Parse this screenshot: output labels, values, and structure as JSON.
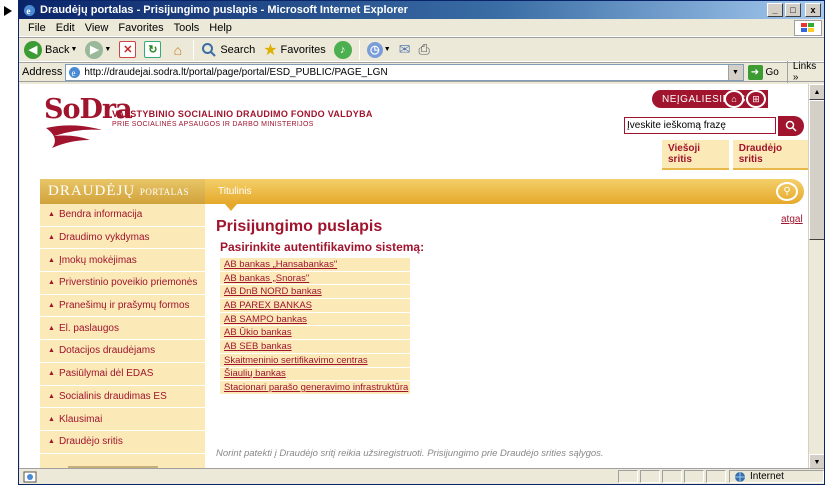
{
  "window": {
    "title": "Draudėjų portalas - Prisijungimo puslapis - Microsoft Internet Explorer",
    "minimize": "_",
    "maximize": "□",
    "close": "x"
  },
  "menu": [
    "File",
    "Edit",
    "View",
    "Favorites",
    "Tools",
    "Help"
  ],
  "toolbar": {
    "back_label": "Back",
    "search_label": "Search",
    "favorites_label": "Favorites"
  },
  "address": {
    "label": "Address",
    "url": "http://draudejai.sodra.lt/portal/page/portal/ESD_PUBLIC/PAGE_LGN",
    "go_label": "Go",
    "links_label": "Links"
  },
  "header": {
    "logo_text": "SoDra",
    "org_name": "VALSTYBINIO SOCIALINIO DRAUDIMO FONDO VALDYBA",
    "org_sub": "PRIE SOCIALINĖS APSAUGOS IR DARBO MINISTERIJOS",
    "neigaliesiems_label": "NEĮGALIESIEMS",
    "search_placeholder": "Įveskite ieškomą frazę",
    "tab_public": "Viešoji sritis",
    "tab_employer": "Draudėjo sritis"
  },
  "banner": {
    "portal_title": "DRAUDĖJŲ",
    "portal_small": "PORTALAS",
    "breadcrumb": "Titulinis"
  },
  "sidebar": {
    "items": [
      "Bendra informacija",
      "Draudimo vykdymas",
      "Įmokų mokėjimas",
      "Priverstinio poveikio priemonės",
      "Pranešimų ir prašymų formos",
      "El. paslaugos",
      "Dotacijos draudėjams",
      "Pasiūlymai dėl EDAS",
      "Socialinis draudimas ES",
      "Klausimai",
      "Draudėjo sritis"
    ]
  },
  "main": {
    "back_link": "atgal",
    "title": "Prisijungimo puslapis",
    "subtitle": "Pasirinkite autentifikavimo sistemą:",
    "banks": [
      "AB bankas „Hansabankas\"",
      "AB bankas „Snoras\"",
      "AB DnB NORD bankas",
      "AB PAREX BANKAS",
      "AB SAMPO bankas",
      "AB Ūkio bankas",
      "AB SEB bankas",
      "Skaitmeninio sertifikavimo centras",
      "Šiaulių bankas",
      "Stacionari parašo generavimo infrastruktūra"
    ],
    "footer_note": "Norint patekti į Draudėjo sritį reikia užsiregistruoti. Prisijungimo prie Draudėjo srities sąlygos."
  },
  "status": {
    "zone": "Internet"
  },
  "colors": {
    "brand": "#a0142d",
    "banner": "#e5a92a",
    "sidebar_bg": "#fbe9b8"
  }
}
